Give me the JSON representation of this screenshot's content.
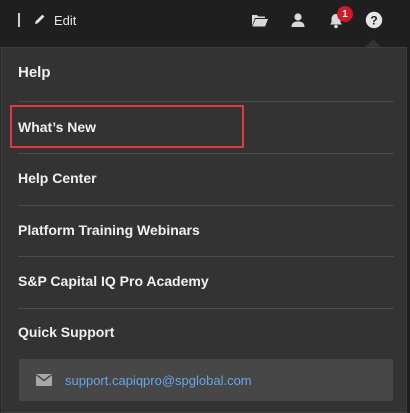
{
  "topbar": {
    "edit_label": "Edit",
    "icons": [
      "folder-icon",
      "user-icon",
      "bell-icon",
      "help-icon"
    ],
    "notification_count": "1"
  },
  "help_menu": {
    "title": "Help",
    "items": [
      {
        "label": "What’s New"
      },
      {
        "label": "Help Center"
      },
      {
        "label": "Platform Training Webinars"
      },
      {
        "label": "S&P Capital IQ Pro Academy"
      },
      {
        "label": "Quick Support"
      }
    ],
    "support_email": "support.capiqpro@spglobal.com"
  },
  "colors": {
    "background": "#1f1f1f",
    "panel": "#333333",
    "highlight_border": "#e03b3b",
    "link": "#6aa5e6",
    "badge": "#d0192b"
  }
}
